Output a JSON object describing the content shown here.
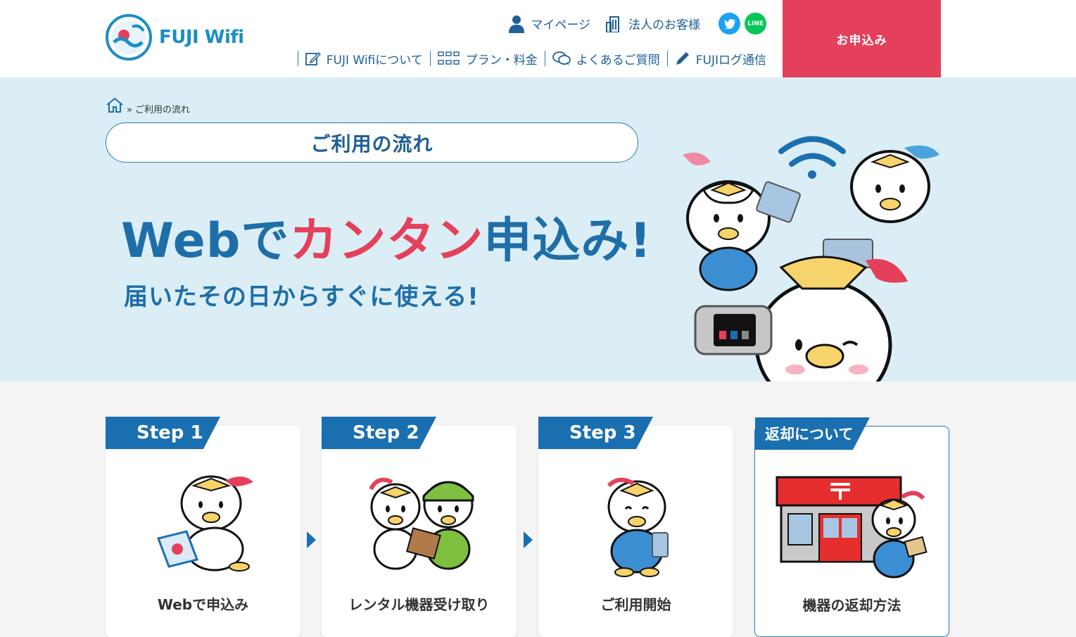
{
  "header": {
    "logo_text": "FUJI Wifi",
    "util_nav": [
      {
        "label": "マイページ",
        "icon": "person-icon"
      },
      {
        "label": "法人のお客様",
        "icon": "building-icon"
      }
    ],
    "social": [
      {
        "icon": "twitter-icon"
      },
      {
        "icon": "line-icon",
        "glyph": "LINE"
      }
    ],
    "main_nav": [
      {
        "label": "FUJI Wifiについて",
        "icon": "edit-icon"
      },
      {
        "label": "プラン・料金",
        "icon": "grid-icon"
      },
      {
        "label": "よくあるご質問",
        "icon": "chat-icon"
      },
      {
        "label": "FUJIログ通信",
        "icon": "pen-icon"
      }
    ],
    "apply_label": "お申込み",
    "colors": {
      "brand_blue": "#1e5f96",
      "accent_pink": "#e5405b"
    }
  },
  "hero": {
    "breadcrumb_sep": "»",
    "breadcrumb_current": "ご利用の流れ",
    "page_title": "ご利用の流れ",
    "headline_a": "Webで",
    "headline_b": "カンタン",
    "headline_c": "申込み!",
    "subline": "届いたその日からすぐに使える!"
  },
  "steps": [
    {
      "tab": "Step 1",
      "label": "Webで申込み"
    },
    {
      "tab": "Step 2",
      "label": "レンタル機器受け取り"
    },
    {
      "tab": "Step 3",
      "label": "ご利用開始"
    },
    {
      "tab": "返却について",
      "label": "機器の返却方法"
    }
  ]
}
